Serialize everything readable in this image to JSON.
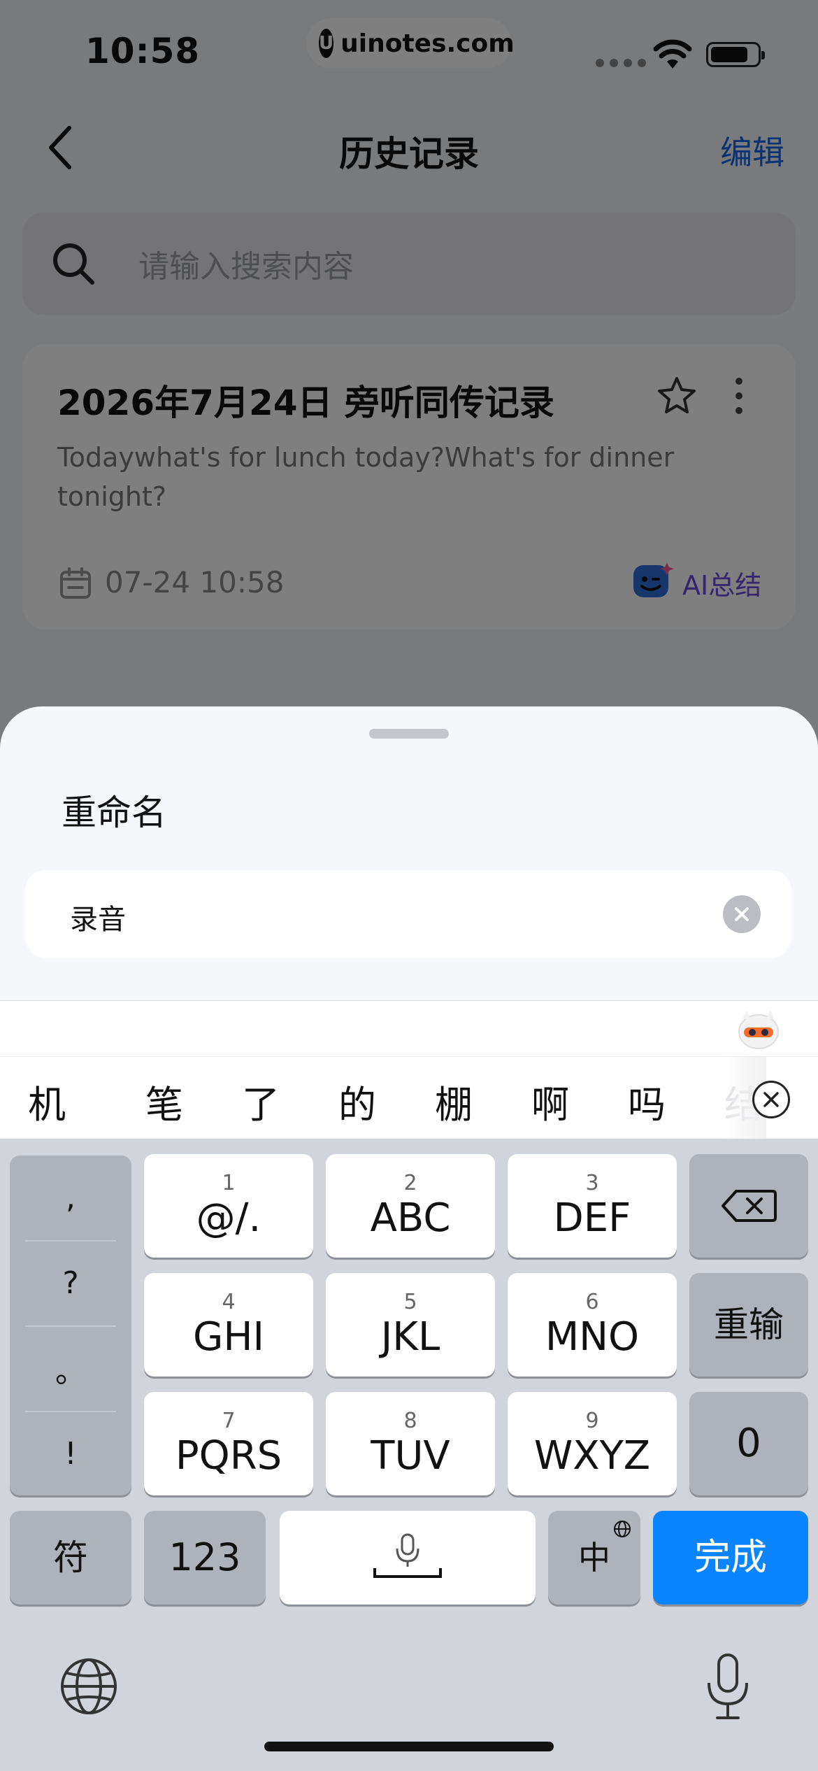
{
  "status": {
    "time": "10:58",
    "site_logo": "U",
    "site_pill": "uinotes.com"
  },
  "nav": {
    "title": "历史记录",
    "edit": "编辑"
  },
  "search": {
    "placeholder": "请输入搜索内容"
  },
  "record": {
    "title": "2026年7月24日 旁听同传记录",
    "preview": "Todaywhat's for lunch today?What's for dinner tonight?",
    "date": "07-24 10:58",
    "ai_summary": "AI总结"
  },
  "sheet": {
    "title": "重命名",
    "value": "录音"
  },
  "keyboard": {
    "candidates": [
      "机",
      "笔",
      "了",
      "的",
      "棚",
      "啊",
      "吗"
    ],
    "candidate_partial": "结",
    "punctuation": [
      ",",
      "?",
      "。",
      "!"
    ],
    "keys": [
      {
        "num": "1",
        "label": "@/."
      },
      {
        "num": "2",
        "label": "ABC"
      },
      {
        "num": "3",
        "label": "DEF"
      },
      {
        "num": "4",
        "label": "GHI"
      },
      {
        "num": "5",
        "label": "JKL"
      },
      {
        "num": "6",
        "label": "MNO"
      },
      {
        "num": "7",
        "label": "PQRS"
      },
      {
        "num": "8",
        "label": "TUV"
      },
      {
        "num": "9",
        "label": "WXYZ"
      }
    ],
    "retype": "重输",
    "zero": "0",
    "symbols": "符",
    "numbers": "123",
    "lang": "中",
    "done": "完成"
  },
  "icons": {
    "back": "chevron-left-icon",
    "search": "search-icon",
    "star": "star-icon",
    "more": "more-vertical-icon",
    "calendar": "calendar-icon",
    "clear": "clear-icon",
    "backspace": "backspace-icon",
    "globe": "globe-icon",
    "mic": "microphone-icon"
  },
  "colors": {
    "accent": "#1565e0",
    "done_key": "#0a84ff",
    "ai_label": "#6a4be0"
  }
}
